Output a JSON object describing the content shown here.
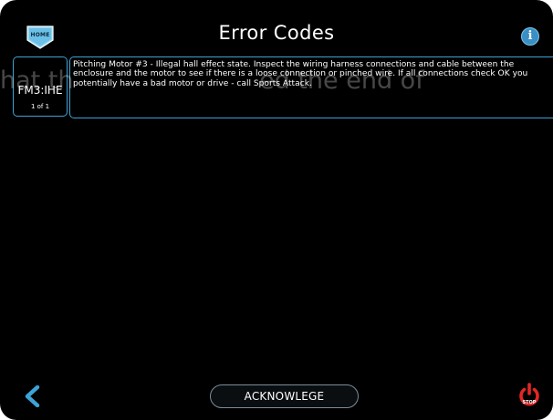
{
  "header": {
    "home_label": "HOME",
    "title": "Error Codes",
    "info_label": "i"
  },
  "overlay": {
    "left_fragment": "hat th",
    "right_fragment": "ed the end of"
  },
  "error": {
    "code": "FM3:IHE",
    "pager": "1  of  1",
    "description": "Pitching Motor #3 - Illegal hall effect state. Inspect the wiring harness connections and cable between the enclosure and the motor to see if there is a loose connection or pinched wire. If all connections check OK you potentially have a bad motor or drive - call Sports Attack."
  },
  "footer": {
    "acknowledge_label": "ACKNOWLEGE",
    "stop_label": "STOP"
  },
  "colors": {
    "background": "#000000",
    "accent": "#3da3d6",
    "stop_red": "#e32626"
  }
}
